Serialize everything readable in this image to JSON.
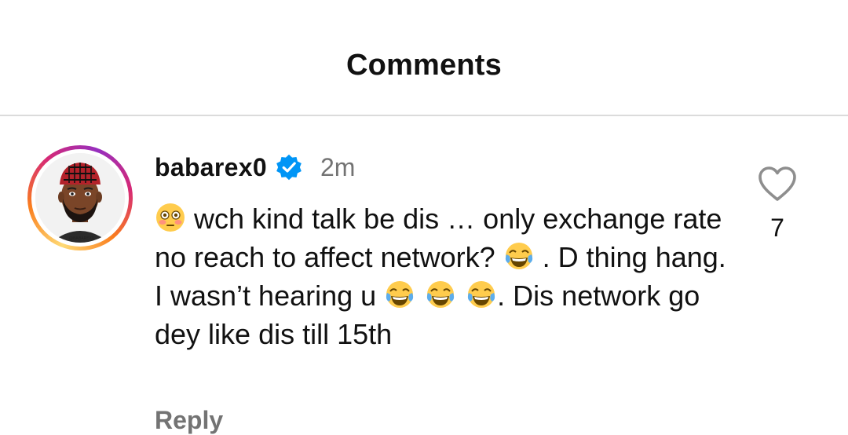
{
  "header": {
    "title": "Comments"
  },
  "comment": {
    "username": "babarex0",
    "time": "2m",
    "avatar_label": "@BABAREX0",
    "segments": {
      "s1": "wch kind talk be dis … only exchange rate no reach to affect network? ",
      "s2": ". D thing hang.  I wasn’t hearing u ",
      "s3": ". Dis network go dey like dis till 15th"
    },
    "like_count": "7",
    "reply_label": "Reply"
  },
  "icons": {
    "verified": "verified-badge-icon",
    "heart": "heart-outline-icon",
    "flushed": "flushed-face-emoji",
    "joy": "tears-of-joy-emoji"
  },
  "colors": {
    "verified_blue": "#0095f6",
    "muted_text": "#737373",
    "divider": "#dbdbdb"
  }
}
